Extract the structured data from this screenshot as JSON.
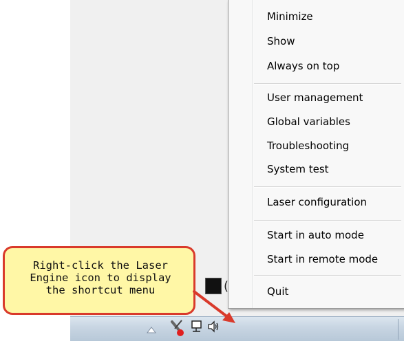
{
  "context_menu": {
    "groups": [
      [
        "Minimize",
        "Show",
        "Always on top"
      ],
      [
        "User management",
        "Global variables",
        "Troubleshooting",
        "System test"
      ],
      [
        "Laser configuration"
      ],
      [
        "Start in auto mode",
        "Start in remote mode"
      ],
      [
        "Quit"
      ]
    ]
  },
  "callout": {
    "text": "Right-click the Laser\nEngine icon to display\nthe shortcut menu"
  },
  "tray": {
    "icons": [
      "show-hidden-icons-icon",
      "laser-engine-icon",
      "network-icon",
      "volume-icon"
    ]
  },
  "colors": {
    "callout_fill": "#fff7a6",
    "callout_border": "#d93a2b",
    "arrow": "#d93a2b",
    "menu_bg": "#f8f8f8"
  }
}
